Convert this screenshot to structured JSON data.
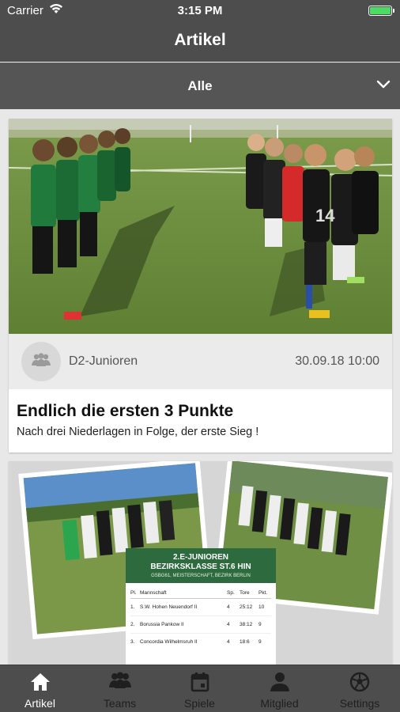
{
  "status_bar": {
    "carrier": "Carrier",
    "time": "3:15 PM",
    "battery_level": 1.0
  },
  "nav": {
    "title": "Artikel"
  },
  "filter": {
    "selected": "Alle",
    "icon": "chevron-down-icon"
  },
  "articles": [
    {
      "team": "D2-Junioren",
      "date": "30.09.18 10:00",
      "title": "Endlich die ersten 3 Punkte",
      "subtitle": "Nach drei Niederlagen in Folge, der erste Sieg !"
    },
    {
      "poster_heading_1": "2.E-JUNIOREN",
      "poster_heading_2": "BEZIRKSKLASSE ST.6 HIN",
      "poster_caption": "GSBG61, MEISTERSCHAFT, BEZIRK BERLIN",
      "table_headers": [
        "Pl.",
        "Mannschaft",
        "Sp.",
        "Tore",
        "Pkt."
      ],
      "table_rows": [
        [
          "1.",
          "S.W. Hohen Neuendorf II",
          "4",
          "25:12",
          "10"
        ],
        [
          "2.",
          "Borussia Pankow II",
          "4",
          "38:12",
          "9"
        ],
        [
          "3.",
          "Concordia Wilhelmsruh II",
          "4",
          "18:6",
          "9"
        ]
      ]
    }
  ],
  "tabs": [
    {
      "label": "Artikel",
      "icon": "home-icon",
      "active": true
    },
    {
      "label": "Teams",
      "icon": "group-icon",
      "active": false
    },
    {
      "label": "Spiele",
      "icon": "calendar-icon",
      "active": false
    },
    {
      "label": "Mitglied",
      "icon": "person-icon",
      "active": false
    },
    {
      "label": "Settings",
      "icon": "ball-icon",
      "active": false
    }
  ],
  "colors": {
    "bar_bg": "#4d4d4d",
    "active_tab": "#ffffff",
    "inactive_tab": "#1f1f1f",
    "battery": "#4cd964"
  }
}
